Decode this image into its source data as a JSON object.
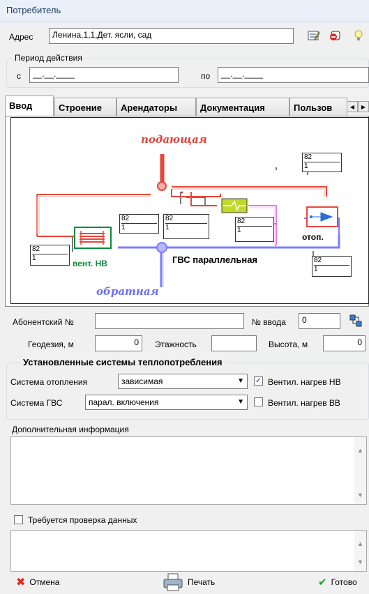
{
  "window": {
    "title": "Потребитель"
  },
  "address": {
    "label": "Адрес",
    "value": "Ленина,1,1,Дет. ясли, сад"
  },
  "period": {
    "title": "Период действия",
    "from_label": "с",
    "from_value": "__.__.____",
    "to_label": "по",
    "to_value": "__.__.____"
  },
  "tabs": [
    {
      "label": "Ввод",
      "active": true
    },
    {
      "label": "Строение"
    },
    {
      "label": "Арендаторы"
    },
    {
      "label": "Документация"
    },
    {
      "label": "Пользов"
    }
  ],
  "diagram": {
    "supply_label": "подающая",
    "return_label": "обратная",
    "vent_label": "вент. НВ",
    "heat_label": "отоп.",
    "gvs_label": "ГВС параллельная",
    "meters": [
      {
        "top": "82",
        "bottom": "1"
      },
      {
        "top": "82",
        "bottom": "1"
      },
      {
        "top": "82",
        "bottom": "1"
      },
      {
        "top": "82",
        "bottom": "1"
      },
      {
        "top": "82",
        "bottom": "1"
      },
      {
        "top": "82",
        "bottom": "1"
      }
    ],
    "colors": {
      "supply": "#e8463a",
      "return": "#7b7bff",
      "hot_water": "#e37ce3",
      "pipe_dark": "#222222"
    }
  },
  "form": {
    "subscriber_label": "Абонентский №",
    "subscriber_value": "",
    "input_no_label": "№ ввода",
    "input_no_value": "0",
    "geodesy_label": "Геодезия, м",
    "geodesy_value": "0",
    "floors_label": "Этажность",
    "floors_value": "",
    "height_label": "Высота, м",
    "height_value": "0"
  },
  "systems": {
    "title": "Установленные системы теплопотребления",
    "heating_label": "Система отопления",
    "heating_value": "зависимая",
    "gvs_label": "Система ГВС",
    "gvs_value": "парал. включения",
    "vent_hv_label": "Вентил. нагрев НВ",
    "vent_hv_checked": true,
    "vent_vv_label": "Вентил. нагрев ВВ",
    "vent_vv_checked": false
  },
  "extra_info": {
    "label": "Дополнительная информация",
    "value": ""
  },
  "check_data": {
    "label": "Требуется проверка данных",
    "checked": false
  },
  "buttons": {
    "cancel": "Отмена",
    "print": "Печать",
    "done": "Готово"
  },
  "icons": [
    "edit-icon",
    "remove-icon",
    "bulb-icon",
    "connect-icon",
    "cancel-x-icon",
    "printer-icon",
    "checkmark-icon"
  ]
}
